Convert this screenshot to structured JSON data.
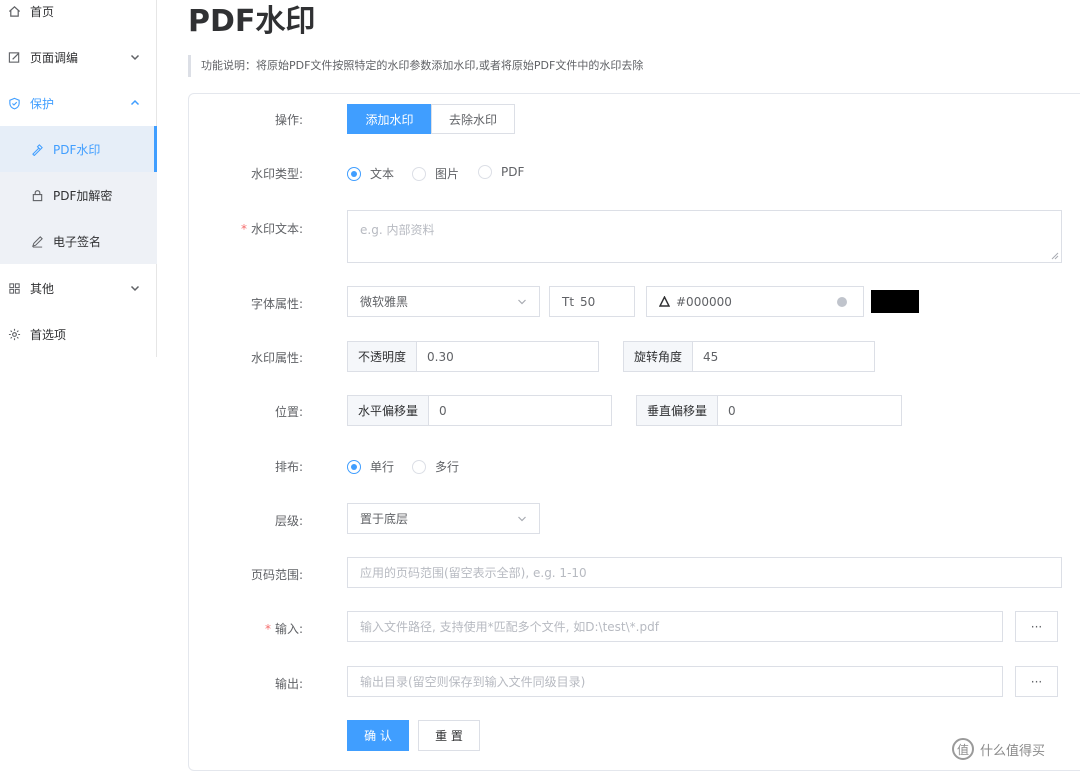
{
  "sidebar": {
    "items": [
      {
        "label": "首页",
        "icon": "home-icon"
      },
      {
        "label": "页面调编",
        "icon": "edit-icon"
      },
      {
        "label": "保护",
        "icon": "shield-icon"
      },
      {
        "label": "其他",
        "icon": "grid-icon"
      },
      {
        "label": "首选项",
        "icon": "gear-icon"
      }
    ],
    "sub_items": [
      {
        "label": "PDF水印",
        "icon": "stamp-icon"
      },
      {
        "label": "PDF加解密",
        "icon": "lock-icon"
      },
      {
        "label": "电子签名",
        "icon": "pen-icon"
      }
    ]
  },
  "page": {
    "title": "PDF水印",
    "description": "功能说明：将原始PDF文件按照特定的水印参数添加水印,或者将原始PDF文件中的水印去除"
  },
  "form": {
    "operation": {
      "label": "操作:",
      "add": "添加水印",
      "remove": "去除水印"
    },
    "type": {
      "label": "水印类型:",
      "options": [
        "文本",
        "图片",
        "PDF"
      ]
    },
    "text": {
      "label": "水印文本:",
      "placeholder": "e.g. 内部资料"
    },
    "font": {
      "label": "字体属性:",
      "family": "微软雅黑",
      "size_prefix": "Tt",
      "size": "50",
      "color": "#000000"
    },
    "watermark_props": {
      "label": "水印属性:",
      "opacity_label": "不透明度",
      "opacity": "0.30",
      "rotation_label": "旋转角度",
      "rotation": "45"
    },
    "position": {
      "label": "位置:",
      "h_label": "水平偏移量",
      "h_value": "0",
      "v_label": "垂直偏移量",
      "v_value": "0"
    },
    "layout": {
      "label": "排布:",
      "options": [
        "单行",
        "多行"
      ]
    },
    "layer": {
      "label": "层级:",
      "value": "置于底层"
    },
    "page_range": {
      "label": "页码范围:",
      "placeholder": "应用的页码范围(留空表示全部), e.g. 1-10"
    },
    "input": {
      "label": "输入:",
      "placeholder": "输入文件路径, 支持使用*匹配多个文件, 如D:\\test\\*.pdf",
      "browse": "···"
    },
    "output": {
      "label": "输出:",
      "placeholder": "输出目录(留空则保存到输入文件同级目录)",
      "browse": "···"
    },
    "confirm": "确 认",
    "reset": "重 置"
  },
  "watermark_site": {
    "text": "什么值得买",
    "icon_char": "值"
  },
  "colors": {
    "primary": "#409eff",
    "required": "#f56c6c",
    "swatch": "#000000"
  }
}
